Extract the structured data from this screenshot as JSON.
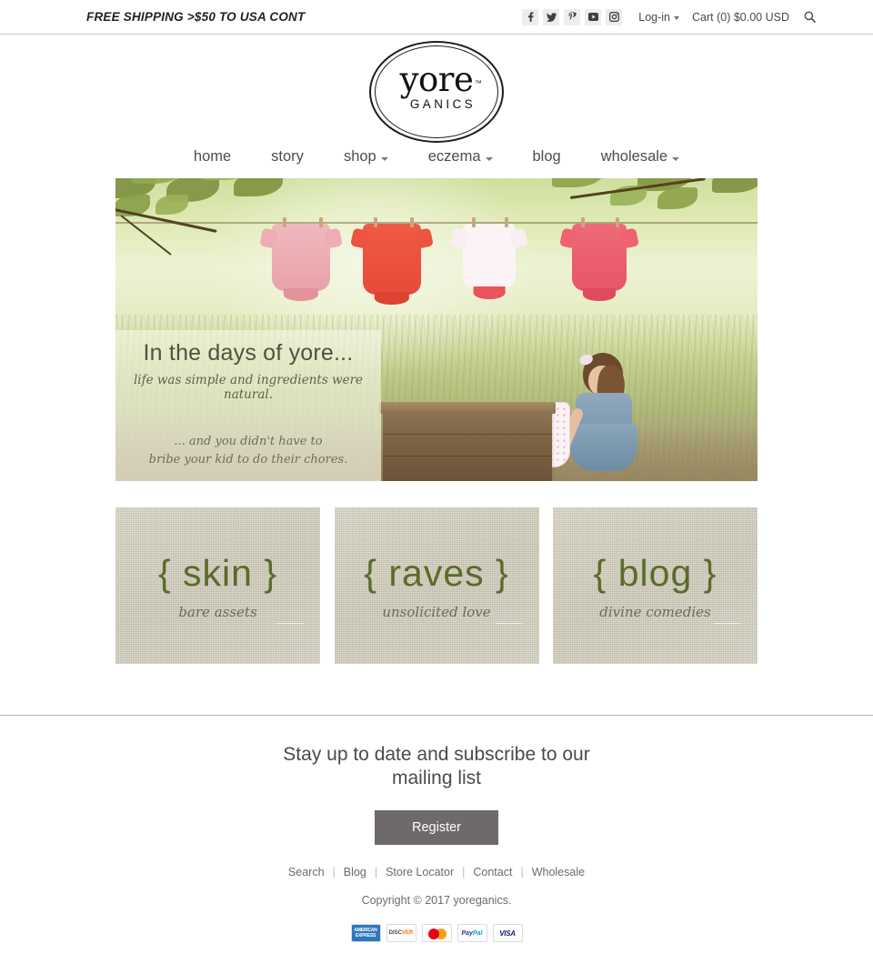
{
  "topbar": {
    "announcement": "FREE SHIPPING >$50 TO USA CONT",
    "social": [
      {
        "name": "facebook-icon",
        "label": "Facebook"
      },
      {
        "name": "twitter-icon",
        "label": "Twitter"
      },
      {
        "name": "pinterest-icon",
        "label": "Pinterest"
      },
      {
        "name": "youtube-icon",
        "label": "YouTube"
      },
      {
        "name": "instagram-icon",
        "label": "Instagram"
      }
    ],
    "login_label": "Log-in",
    "cart_label": "Cart (0) $0.00 USD",
    "search_icon": "search-icon"
  },
  "logo": {
    "word": "yore",
    "tm": "™",
    "subword": "GANICS"
  },
  "nav": [
    {
      "label": "home",
      "dropdown": false
    },
    {
      "label": "story",
      "dropdown": false
    },
    {
      "label": "shop",
      "dropdown": true
    },
    {
      "label": "eczema",
      "dropdown": true
    },
    {
      "label": "blog",
      "dropdown": false
    },
    {
      "label": "wholesale",
      "dropdown": true
    }
  ],
  "hero": {
    "alt": "Toddler girl hanging baby onesies on a clothesline in a sunlit field",
    "headline": "In the days of yore...",
    "subline": "life was simple and ingredients were natural.",
    "tagline_1": "... and you didn't have to",
    "tagline_2": "bribe your kid to do their chores."
  },
  "tiles": [
    {
      "title": "{ skin }",
      "subtitle": "bare assets"
    },
    {
      "title": "{ raves }",
      "subtitle": "unsolicited love"
    },
    {
      "title": "{ blog }",
      "subtitle": "divine comedies"
    }
  ],
  "footer": {
    "subscribe_title": "Stay up to date and subscribe to our mailing list",
    "register_label": "Register",
    "links": [
      "Search",
      "Blog",
      "Store Locator",
      "Contact",
      "Wholesale"
    ],
    "separator": "|",
    "copyright": "Copyright © 2017 yoreganics.",
    "payments": [
      {
        "name": "amex-icon",
        "label": "AMERICAN EXPRESS"
      },
      {
        "name": "discover-icon",
        "label": "DISCOVER"
      },
      {
        "name": "mastercard-icon",
        "label": "MasterCard"
      },
      {
        "name": "paypal-icon",
        "label": "PayPal"
      },
      {
        "name": "visa-icon",
        "label": "VISA"
      }
    ]
  },
  "colors": {
    "tile_text": "#5b6b2c",
    "register_bg": "#6e6a6a",
    "body_text": "#555555"
  }
}
